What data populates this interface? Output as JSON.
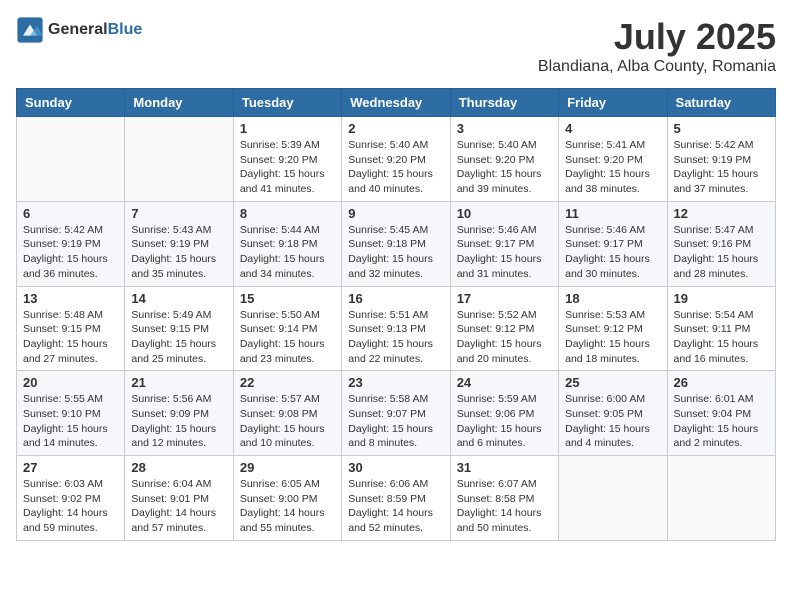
{
  "logo": {
    "text_general": "General",
    "text_blue": "Blue"
  },
  "title": {
    "month": "July 2025",
    "location": "Blandiana, Alba County, Romania"
  },
  "headers": [
    "Sunday",
    "Monday",
    "Tuesday",
    "Wednesday",
    "Thursday",
    "Friday",
    "Saturday"
  ],
  "weeks": [
    [
      {
        "day": "",
        "info": ""
      },
      {
        "day": "",
        "info": ""
      },
      {
        "day": "1",
        "info": "Sunrise: 5:39 AM\nSunset: 9:20 PM\nDaylight: 15 hours and 41 minutes."
      },
      {
        "day": "2",
        "info": "Sunrise: 5:40 AM\nSunset: 9:20 PM\nDaylight: 15 hours and 40 minutes."
      },
      {
        "day": "3",
        "info": "Sunrise: 5:40 AM\nSunset: 9:20 PM\nDaylight: 15 hours and 39 minutes."
      },
      {
        "day": "4",
        "info": "Sunrise: 5:41 AM\nSunset: 9:20 PM\nDaylight: 15 hours and 38 minutes."
      },
      {
        "day": "5",
        "info": "Sunrise: 5:42 AM\nSunset: 9:19 PM\nDaylight: 15 hours and 37 minutes."
      }
    ],
    [
      {
        "day": "6",
        "info": "Sunrise: 5:42 AM\nSunset: 9:19 PM\nDaylight: 15 hours and 36 minutes."
      },
      {
        "day": "7",
        "info": "Sunrise: 5:43 AM\nSunset: 9:19 PM\nDaylight: 15 hours and 35 minutes."
      },
      {
        "day": "8",
        "info": "Sunrise: 5:44 AM\nSunset: 9:18 PM\nDaylight: 15 hours and 34 minutes."
      },
      {
        "day": "9",
        "info": "Sunrise: 5:45 AM\nSunset: 9:18 PM\nDaylight: 15 hours and 32 minutes."
      },
      {
        "day": "10",
        "info": "Sunrise: 5:46 AM\nSunset: 9:17 PM\nDaylight: 15 hours and 31 minutes."
      },
      {
        "day": "11",
        "info": "Sunrise: 5:46 AM\nSunset: 9:17 PM\nDaylight: 15 hours and 30 minutes."
      },
      {
        "day": "12",
        "info": "Sunrise: 5:47 AM\nSunset: 9:16 PM\nDaylight: 15 hours and 28 minutes."
      }
    ],
    [
      {
        "day": "13",
        "info": "Sunrise: 5:48 AM\nSunset: 9:15 PM\nDaylight: 15 hours and 27 minutes."
      },
      {
        "day": "14",
        "info": "Sunrise: 5:49 AM\nSunset: 9:15 PM\nDaylight: 15 hours and 25 minutes."
      },
      {
        "day": "15",
        "info": "Sunrise: 5:50 AM\nSunset: 9:14 PM\nDaylight: 15 hours and 23 minutes."
      },
      {
        "day": "16",
        "info": "Sunrise: 5:51 AM\nSunset: 9:13 PM\nDaylight: 15 hours and 22 minutes."
      },
      {
        "day": "17",
        "info": "Sunrise: 5:52 AM\nSunset: 9:12 PM\nDaylight: 15 hours and 20 minutes."
      },
      {
        "day": "18",
        "info": "Sunrise: 5:53 AM\nSunset: 9:12 PM\nDaylight: 15 hours and 18 minutes."
      },
      {
        "day": "19",
        "info": "Sunrise: 5:54 AM\nSunset: 9:11 PM\nDaylight: 15 hours and 16 minutes."
      }
    ],
    [
      {
        "day": "20",
        "info": "Sunrise: 5:55 AM\nSunset: 9:10 PM\nDaylight: 15 hours and 14 minutes."
      },
      {
        "day": "21",
        "info": "Sunrise: 5:56 AM\nSunset: 9:09 PM\nDaylight: 15 hours and 12 minutes."
      },
      {
        "day": "22",
        "info": "Sunrise: 5:57 AM\nSunset: 9:08 PM\nDaylight: 15 hours and 10 minutes."
      },
      {
        "day": "23",
        "info": "Sunrise: 5:58 AM\nSunset: 9:07 PM\nDaylight: 15 hours and 8 minutes."
      },
      {
        "day": "24",
        "info": "Sunrise: 5:59 AM\nSunset: 9:06 PM\nDaylight: 15 hours and 6 minutes."
      },
      {
        "day": "25",
        "info": "Sunrise: 6:00 AM\nSunset: 9:05 PM\nDaylight: 15 hours and 4 minutes."
      },
      {
        "day": "26",
        "info": "Sunrise: 6:01 AM\nSunset: 9:04 PM\nDaylight: 15 hours and 2 minutes."
      }
    ],
    [
      {
        "day": "27",
        "info": "Sunrise: 6:03 AM\nSunset: 9:02 PM\nDaylight: 14 hours and 59 minutes."
      },
      {
        "day": "28",
        "info": "Sunrise: 6:04 AM\nSunset: 9:01 PM\nDaylight: 14 hours and 57 minutes."
      },
      {
        "day": "29",
        "info": "Sunrise: 6:05 AM\nSunset: 9:00 PM\nDaylight: 14 hours and 55 minutes."
      },
      {
        "day": "30",
        "info": "Sunrise: 6:06 AM\nSunset: 8:59 PM\nDaylight: 14 hours and 52 minutes."
      },
      {
        "day": "31",
        "info": "Sunrise: 6:07 AM\nSunset: 8:58 PM\nDaylight: 14 hours and 50 minutes."
      },
      {
        "day": "",
        "info": ""
      },
      {
        "day": "",
        "info": ""
      }
    ]
  ]
}
